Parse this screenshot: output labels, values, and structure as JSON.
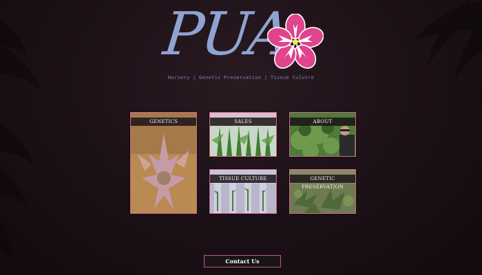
{
  "brand": {
    "logo_text": "PUA",
    "logo_color": "#8fa3d1",
    "flower_color": "#e0448c",
    "tagline": "Nursery | Genetic Preservation | Tissue Culutre"
  },
  "tiles": [
    {
      "label": "GENETICS",
      "image": "cannabis-bud-photo"
    },
    {
      "label": "SALES",
      "image": "seedlings-photo"
    },
    {
      "label": "ABOUT",
      "image": "grower-with-plants-photo"
    },
    {
      "label": "TISSUE CULTURE",
      "image": "tissue-culture-tubes-photo"
    },
    {
      "label": "GENETIC PRESERVATION",
      "image": "plant-canopy-photo"
    }
  ],
  "contact": {
    "label": "Contact Us"
  },
  "colors": {
    "accent_border": "#d4688d",
    "background": "#1b1016"
  }
}
